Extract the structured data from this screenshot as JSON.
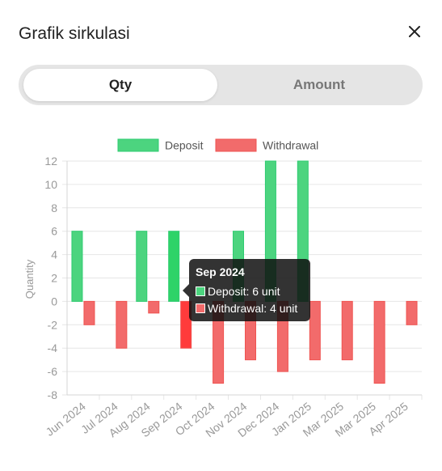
{
  "dialog": {
    "title": "Grafik sirkulasi",
    "close_icon": "close-icon"
  },
  "tabs": [
    {
      "label": "Qty",
      "active": true
    },
    {
      "label": "Amount",
      "active": false
    }
  ],
  "colors": {
    "deposit": "#4cd47f",
    "deposit_border": "#2ecc71",
    "withdrawal": "#f26b6b",
    "withdrawal_border": "#ef5350",
    "grid": "#e6e6e6",
    "axis_text": "#999999"
  },
  "chart_data": {
    "type": "bar",
    "categories": [
      "Jun 2024",
      "Jul 2024",
      "Aug 2024",
      "Sep 2024",
      "Oct 2024",
      "Nov 2024",
      "Dec 2024",
      "Jan 2025",
      "Mar 2025",
      "Mar 2025",
      "Apr 2025"
    ],
    "series": [
      {
        "name": "Deposit",
        "values": [
          6,
          0,
          6,
          6,
          0,
          6,
          12,
          12,
          0,
          0,
          0
        ]
      },
      {
        "name": "Withdrawal",
        "values": [
          -2,
          -4,
          -1,
          -4,
          -7,
          -5,
          -6,
          -5,
          -5,
          -7,
          -2
        ]
      }
    ],
    "ylabel": "Quantity",
    "xlabel": "",
    "ylim": [
      -8,
      12
    ],
    "yticks": [
      12,
      10,
      8,
      6,
      4,
      2,
      0,
      -2,
      -4,
      -6,
      -8
    ],
    "legend_position": "top",
    "grid": true,
    "highlighted_index": 3,
    "tooltip": {
      "title": "Sep 2024",
      "lines": [
        "Deposit: 6 unit",
        "Withdrawal: 4 unit"
      ]
    }
  }
}
